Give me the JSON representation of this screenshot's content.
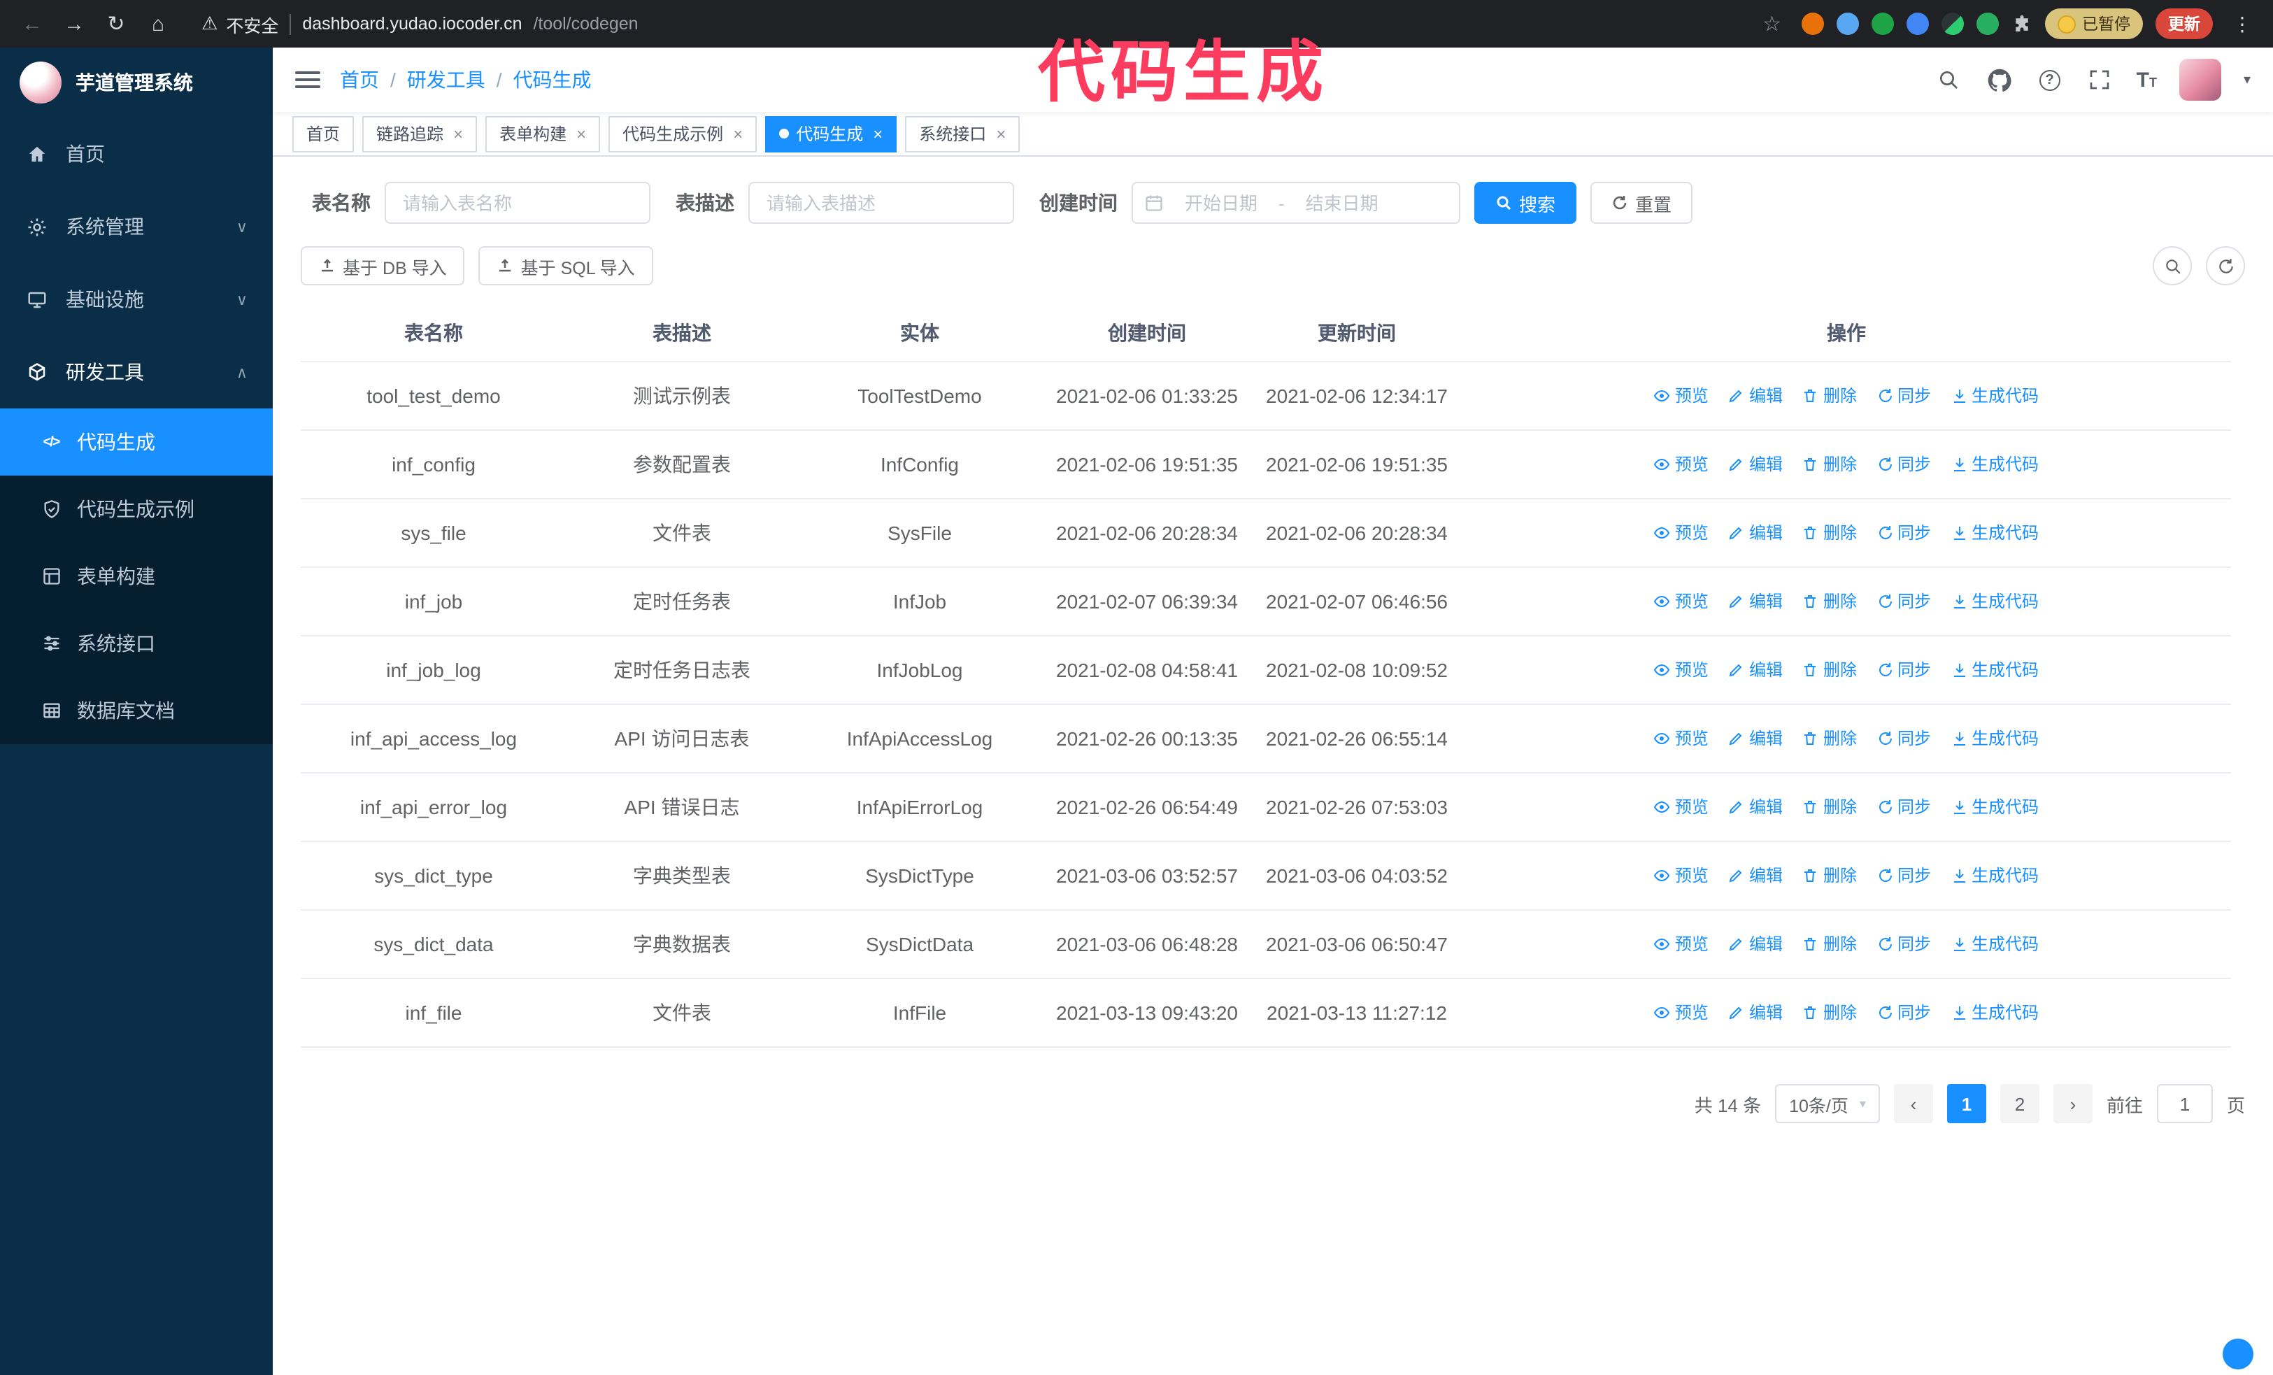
{
  "colors": {
    "accent": "#1890ff",
    "annotation": "#fb3c5f",
    "sidebar_bg": "#0a2e48",
    "submenu_bg": "#051f31",
    "chrome_bg": "#202124",
    "update_badge": "#d9473a",
    "paused_badge": "#d9c47e"
  },
  "annotation": {
    "text": "代码生成"
  },
  "browser": {
    "security_label": "不安全",
    "url_host": "dashboard.yudao.iocoder.cn",
    "url_path": "/tool/codegen",
    "paused_badge": "已暂停",
    "update_button": "更新"
  },
  "icons": {
    "back": "←",
    "forward": "→",
    "reload": "↻",
    "home": "⌂",
    "warning": "⚠",
    "star": "☆",
    "kebab": "⋮",
    "close": "×",
    "caret_down": "▾",
    "chevron_down": "∨",
    "chevron_up": "∧",
    "question": "?",
    "font_size": "T",
    "code": "</>",
    "prev": "‹",
    "next": "›"
  },
  "sidebar": {
    "logo_title": "芋道管理系统",
    "items": [
      {
        "label": "首页"
      },
      {
        "label": "系统管理"
      },
      {
        "label": "基础设施"
      },
      {
        "label": "研发工具"
      }
    ],
    "submenu": [
      {
        "label": "代码生成"
      },
      {
        "label": "代码生成示例"
      },
      {
        "label": "表单构建"
      },
      {
        "label": "系统接口"
      },
      {
        "label": "数据库文档"
      }
    ]
  },
  "header": {
    "breadcrumb": [
      "首页",
      "研发工具",
      "代码生成"
    ],
    "separator": "/"
  },
  "tabs": [
    {
      "label": "首页"
    },
    {
      "label": "链路追踪"
    },
    {
      "label": "表单构建"
    },
    {
      "label": "代码生成示例"
    },
    {
      "label": "代码生成"
    },
    {
      "label": "系统接口"
    }
  ],
  "filters": {
    "table_name_label": "表名称",
    "table_name_placeholder": "请输入表名称",
    "table_desc_label": "表描述",
    "table_desc_placeholder": "请输入表描述",
    "create_time_label": "创建时间",
    "date_start_placeholder": "开始日期",
    "date_separator": "-",
    "date_end_placeholder": "结束日期",
    "search_button": "搜索",
    "reset_button": "重置"
  },
  "toolbar": {
    "import_db_button": "基于 DB 导入",
    "import_sql_button": "基于 SQL 导入"
  },
  "table": {
    "columns": [
      "表名称",
      "表描述",
      "实体",
      "创建时间",
      "更新时间",
      "操作"
    ],
    "actions": [
      "预览",
      "编辑",
      "删除",
      "同步",
      "生成代码"
    ],
    "rows": [
      {
        "name": "tool_test_demo",
        "desc": "测试示例表",
        "entity": "ToolTestDemo",
        "created": "2021-02-06 01:33:25",
        "updated": "2021-02-06 12:34:17"
      },
      {
        "name": "inf_config",
        "desc": "参数配置表",
        "entity": "InfConfig",
        "created": "2021-02-06 19:51:35",
        "updated": "2021-02-06 19:51:35"
      },
      {
        "name": "sys_file",
        "desc": "文件表",
        "entity": "SysFile",
        "created": "2021-02-06 20:28:34",
        "updated": "2021-02-06 20:28:34"
      },
      {
        "name": "inf_job",
        "desc": "定时任务表",
        "entity": "InfJob",
        "created": "2021-02-07 06:39:34",
        "updated": "2021-02-07 06:46:56"
      },
      {
        "name": "inf_job_log",
        "desc": "定时任务日志表",
        "entity": "InfJobLog",
        "created": "2021-02-08 04:58:41",
        "updated": "2021-02-08 10:09:52"
      },
      {
        "name": "inf_api_access_log",
        "desc": "API 访问日志表",
        "entity": "InfApiAccessLog",
        "created": "2021-02-26 00:13:35",
        "updated": "2021-02-26 06:55:14"
      },
      {
        "name": "inf_api_error_log",
        "desc": "API 错误日志",
        "entity": "InfApiErrorLog",
        "created": "2021-02-26 06:54:49",
        "updated": "2021-02-26 07:53:03"
      },
      {
        "name": "sys_dict_type",
        "desc": "字典类型表",
        "entity": "SysDictType",
        "created": "2021-03-06 03:52:57",
        "updated": "2021-03-06 04:03:52"
      },
      {
        "name": "sys_dict_data",
        "desc": "字典数据表",
        "entity": "SysDictData",
        "created": "2021-03-06 06:48:28",
        "updated": "2021-03-06 06:50:47"
      },
      {
        "name": "inf_file",
        "desc": "文件表",
        "entity": "InfFile",
        "created": "2021-03-13 09:43:20",
        "updated": "2021-03-13 11:27:12"
      }
    ]
  },
  "pagination": {
    "total": "共 14 条",
    "page_size": "10条/页",
    "pages": [
      "1",
      "2"
    ],
    "goto_label": "前往",
    "goto_value": "1",
    "goto_suffix": "页"
  }
}
